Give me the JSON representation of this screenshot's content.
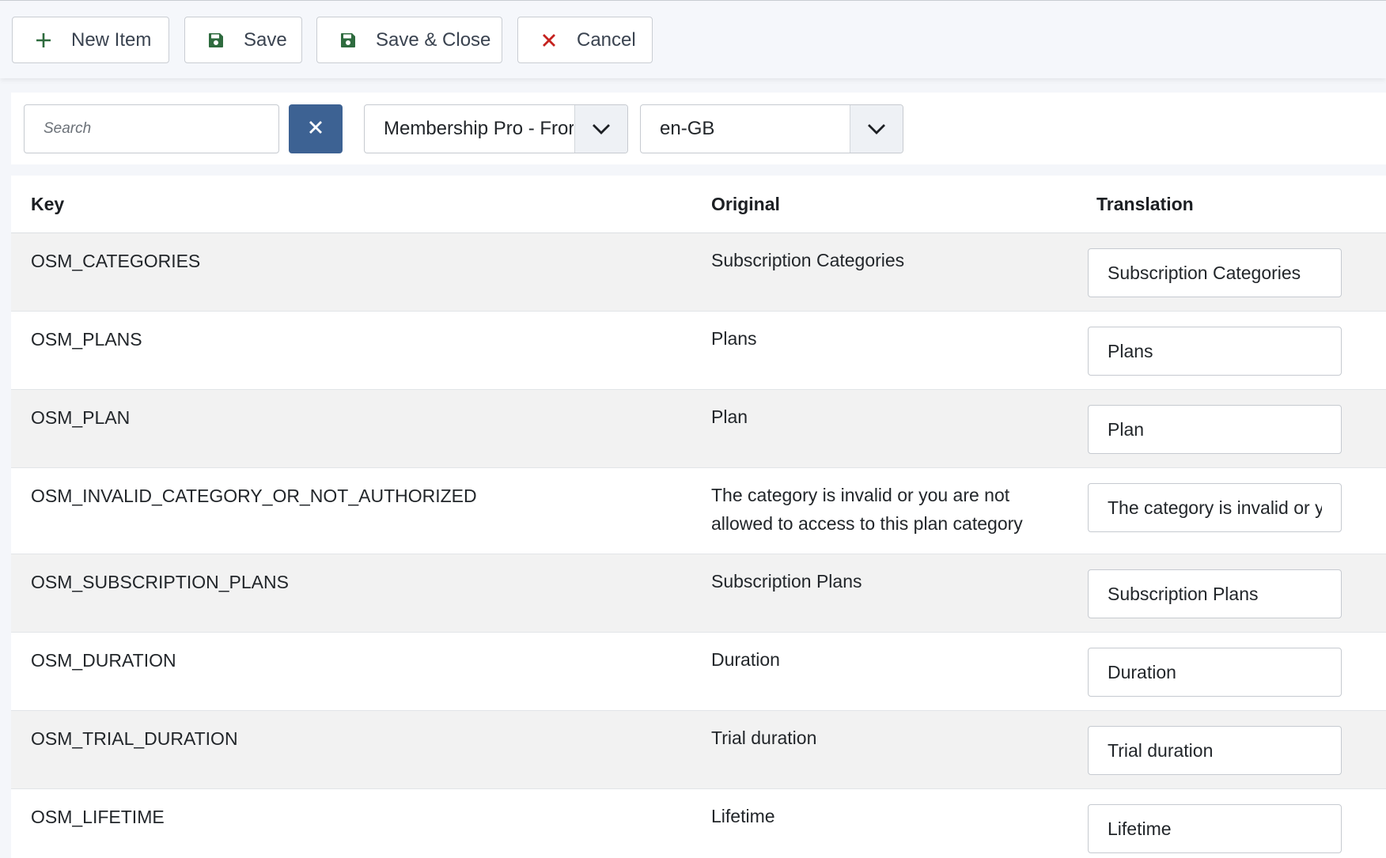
{
  "toolbar": {
    "new_item": "New Item",
    "save": "Save",
    "save_close": "Save & Close",
    "cancel": "Cancel"
  },
  "filters": {
    "search_placeholder": "Search",
    "search_value": "",
    "component_selected": "Membership Pro - Fror",
    "language_selected": "en-GB"
  },
  "table": {
    "headers": {
      "key": "Key",
      "original": "Original",
      "translation": "Translation"
    },
    "rows": [
      {
        "key": "OSM_CATEGORIES",
        "original": "Subscription Categories",
        "translation": "Subscription Categories"
      },
      {
        "key": "OSM_PLANS",
        "original": "Plans",
        "translation": "Plans"
      },
      {
        "key": "OSM_PLAN",
        "original": "Plan",
        "translation": "Plan"
      },
      {
        "key": "OSM_INVALID_CATEGORY_OR_NOT_AUTHORIZED",
        "original": "The category is invalid or you are not allowed to access to this plan category",
        "translation": "The category is invalid or you are not allowed to access to this plan category"
      },
      {
        "key": "OSM_SUBSCRIPTION_PLANS",
        "original": "Subscription Plans",
        "translation": "Subscription Plans"
      },
      {
        "key": "OSM_DURATION",
        "original": "Duration",
        "translation": "Duration"
      },
      {
        "key": "OSM_TRIAL_DURATION",
        "original": "Trial duration",
        "translation": "Trial duration"
      },
      {
        "key": "OSM_LIFETIME",
        "original": "Lifetime",
        "translation": "Lifetime"
      }
    ]
  },
  "colors": {
    "primary": "#3d6293",
    "save_icon": "#2e6b3e",
    "cancel_icon": "#c5221f",
    "new_icon": "#2e6b3e"
  },
  "icons": {
    "new_item": "plus-icon",
    "save": "floppy-disk-icon",
    "save_close": "floppy-disk-icon",
    "cancel": "close-icon",
    "clear": "close-icon",
    "dropdown": "chevron-down-icon"
  }
}
